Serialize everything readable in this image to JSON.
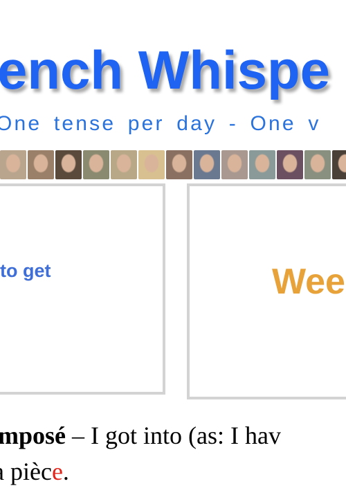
{
  "header": {
    "title": "ench Whispe",
    "subtitle": "One tense per day  -  One v"
  },
  "photo_strip": {
    "count": 13,
    "colors": [
      "#b9a58e",
      "#9a8068",
      "#5a4a3c",
      "#8a8a70",
      "#b8a888",
      "#d8c090",
      "#8a7060",
      "#6a7890",
      "#a89890",
      "#8a9a98",
      "#6a5060",
      "#8a9080",
      "#4a4038"
    ]
  },
  "cards": {
    "left_text": "to get",
    "right_text": "Wee",
    "left_color": "#3f6fd6",
    "right_color": "#e8a23a"
  },
  "body": {
    "line1_bold": "mposé",
    "line1_rest": " – I got into (as: I hav",
    "line2_start": "a pièc",
    "line2_red": "e",
    "line2_end": "."
  }
}
